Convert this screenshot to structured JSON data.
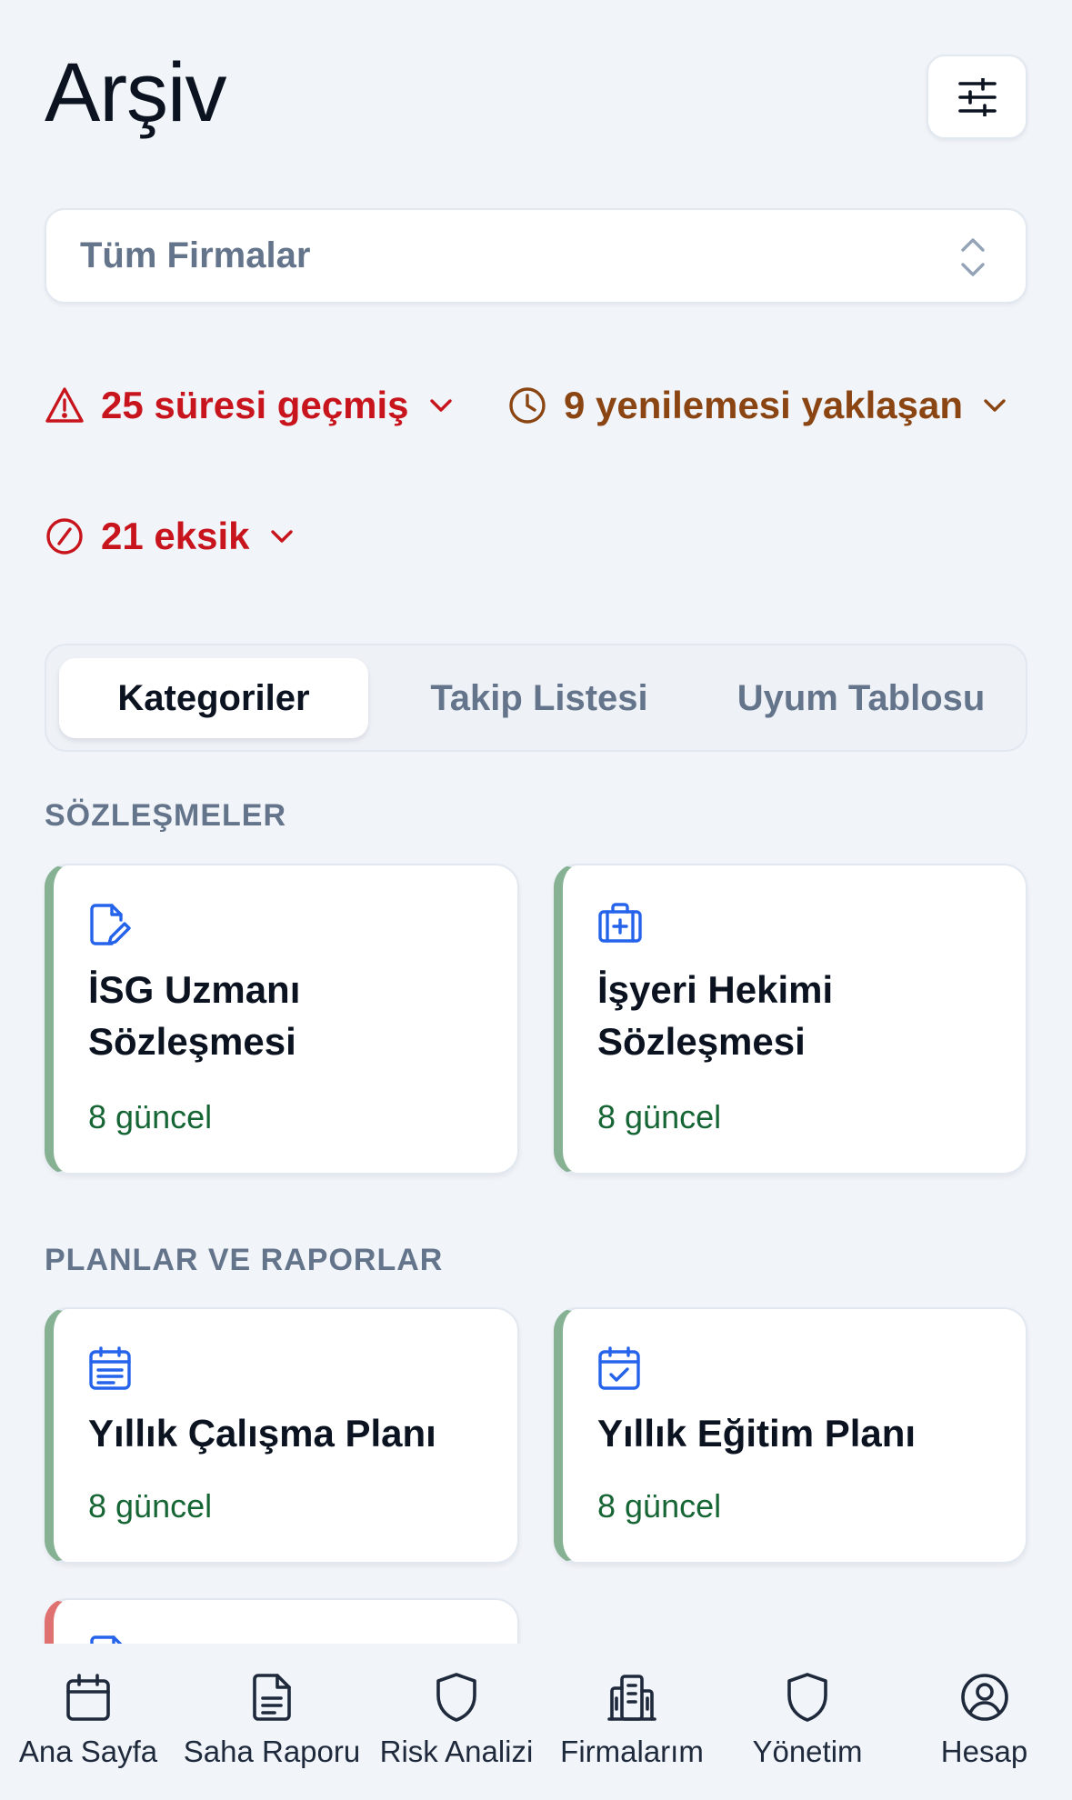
{
  "header": {
    "title": "Arşiv"
  },
  "filter": {
    "firm_select_value": "Tüm Firmalar"
  },
  "alerts": {
    "expired": {
      "label": "25 süresi geçmiş"
    },
    "renewal": {
      "label": "9 yenilemesi yaklaşan"
    },
    "missing": {
      "label": "21 eksik"
    }
  },
  "tabs": [
    {
      "label": "Kategoriler",
      "active": true
    },
    {
      "label": "Takip Listesi",
      "active": false
    },
    {
      "label": "Uyum Tablosu",
      "active": false
    }
  ],
  "sections": [
    {
      "label": "SÖZLEŞMELER",
      "cards": [
        {
          "icon": "file-edit-icon",
          "title": "İSG Uzmanı Sözleşmesi",
          "status": "8 güncel"
        },
        {
          "icon": "medical-kit-icon",
          "title": "İşyeri Hekimi Sözleşmesi",
          "status": "8 güncel"
        }
      ]
    },
    {
      "label": "PLANLAR VE RAPORLAR",
      "cards": [
        {
          "icon": "calendar-list-icon",
          "title": "Yıllık Çalışma Planı",
          "status": "8 güncel"
        },
        {
          "icon": "calendar-check-icon",
          "title": "Yıllık Eğitim Planı",
          "status": "8 güncel"
        }
      ]
    }
  ],
  "bottom_nav": [
    {
      "label": "Ana Sayfa",
      "icon": "calendar-icon"
    },
    {
      "label": "Saha Raporu",
      "icon": "document-icon"
    },
    {
      "label": "Risk Analizi",
      "icon": "shield-icon"
    },
    {
      "label": "Firmalarım",
      "icon": "building-icon"
    },
    {
      "label": "Yönetim",
      "icon": "shield-icon"
    },
    {
      "label": "Hesap",
      "icon": "user-circle-icon"
    }
  ],
  "colors": {
    "danger": "#c8141c",
    "warning": "#8a4512",
    "success": "#166534",
    "accent_icon": "#2563eb",
    "card_edge_ok": "#86b293",
    "card_edge_bad": "#e07171"
  }
}
